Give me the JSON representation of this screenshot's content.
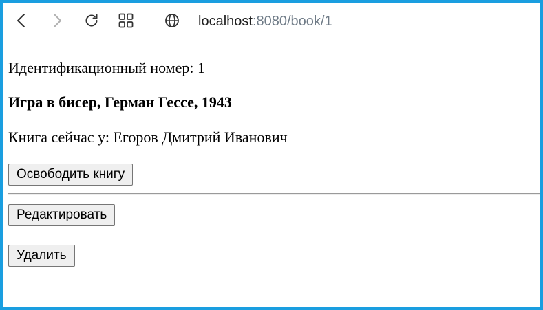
{
  "browser": {
    "icons": {
      "back": "chevron-left-icon",
      "forward": "chevron-right-icon",
      "reload": "reload-icon",
      "apps": "apps-grid-icon",
      "site": "globe-icon"
    },
    "address": {
      "host": "localhost",
      "path": ":8080/book/1"
    },
    "colors": {
      "frame": "#1a9ee0",
      "path_text": "#6e7a86",
      "forward_disabled": "#b0b0b0"
    }
  },
  "book": {
    "id_line": "Идентификационный номер: 1",
    "title_line": "Игра в бисер, Герман Гессе, 1943",
    "holder_line": "Книга сейчас у: Егоров Дмитрий Иванович"
  },
  "actions": {
    "release_label": "Освободить книгу",
    "edit_label": "Редактировать",
    "delete_label": "Удалить"
  }
}
